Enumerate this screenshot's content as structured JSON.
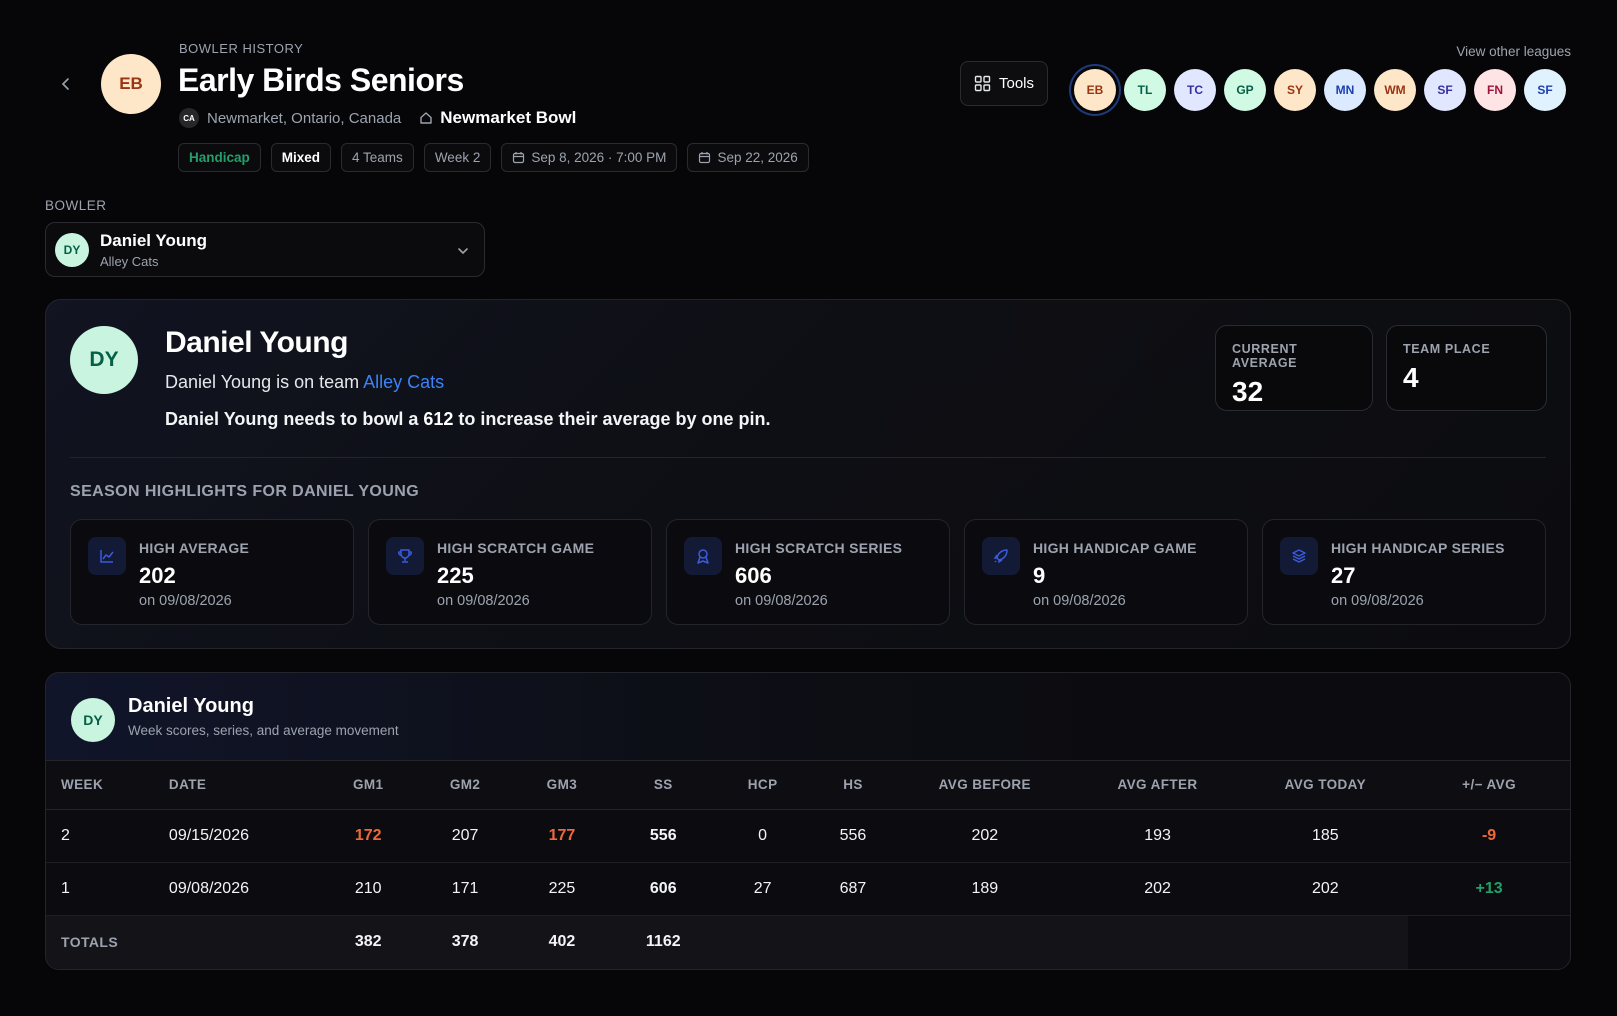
{
  "header": {
    "eyebrow": "BOWLER HISTORY",
    "title": "Early Birds Seniors",
    "avatar": "EB",
    "flag": "CA",
    "location": "Newmarket, Ontario, Canada",
    "venue": "Newmarket Bowl",
    "chips": [
      "Handicap",
      "Mixed",
      "4 Teams",
      "Week 2",
      "Sep 8, 2026 · 7:00 PM",
      "Sep 22, 2026"
    ],
    "tools_label": "Tools",
    "view_other": "View other leagues"
  },
  "leagues": [
    {
      "code": "EB",
      "bg": "#fde7c8",
      "fg": "#9a3412"
    },
    {
      "code": "TL",
      "bg": "#d1fae5",
      "fg": "#065f46"
    },
    {
      "code": "TC",
      "bg": "#e0e7ff",
      "fg": "#3730a3"
    },
    {
      "code": "GP",
      "bg": "#d1fae5",
      "fg": "#065f46"
    },
    {
      "code": "SY",
      "bg": "#fde7c8",
      "fg": "#9a3412"
    },
    {
      "code": "MN",
      "bg": "#dbeafe",
      "fg": "#1e40af"
    },
    {
      "code": "WM",
      "bg": "#fde7c8",
      "fg": "#9a3412"
    },
    {
      "code": "SF",
      "bg": "#e0e7ff",
      "fg": "#3730a3"
    },
    {
      "code": "FN",
      "bg": "#ffe4e6",
      "fg": "#9f1239"
    },
    {
      "code": "SF",
      "bg": "#e0f2fe",
      "fg": "#1e40af"
    }
  ],
  "bowler_select": {
    "label": "BOWLER",
    "initials": "DY",
    "name": "Daniel Young",
    "team": "Alley Cats"
  },
  "profile": {
    "initials": "DY",
    "name": "Daniel Young",
    "team_prefix": "Daniel Young is on team ",
    "team": "Alley Cats",
    "need_prefix": "Daniel Young needs to bowl a ",
    "need_value": "612",
    "need_suffix": " to increase their average by one pin.",
    "current_average_label": "CURRENT AVERAGE",
    "current_average": "32",
    "team_place_label": "TEAM PLACE",
    "team_place": "4",
    "highlights_title": "SEASON HIGHLIGHTS FOR DANIEL YOUNG",
    "highlights": [
      {
        "label": "HIGH AVERAGE",
        "value": "202",
        "date": "on 09/08/2026",
        "icon": "chart-line-icon"
      },
      {
        "label": "HIGH SCRATCH GAME",
        "value": "225",
        "date": "on 09/08/2026",
        "icon": "trophy-icon"
      },
      {
        "label": "HIGH SCRATCH SERIES",
        "value": "606",
        "date": "on 09/08/2026",
        "icon": "award-icon"
      },
      {
        "label": "HIGH HANDICAP GAME",
        "value": "9",
        "date": "on 09/08/2026",
        "icon": "rocket-icon"
      },
      {
        "label": "HIGH HANDICAP SERIES",
        "value": "27",
        "date": "on 09/08/2026",
        "icon": "layers-icon"
      }
    ]
  },
  "history": {
    "initials": "DY",
    "name": "Daniel Young",
    "subtitle": "Week scores, series, and average movement",
    "columns": [
      "WEEK",
      "DATE",
      "GM1",
      "GM2",
      "GM3",
      "SS",
      "HCP",
      "HS",
      "AVG BEFORE",
      "AVG AFTER",
      "AVG TODAY",
      "+/− AVG"
    ],
    "rows": [
      {
        "week": "2",
        "date": "09/15/2026",
        "gm1": "172",
        "gm2": "207",
        "gm3": "177",
        "ss": "556",
        "hcp": "0",
        "hs": "556",
        "avg_before": "202",
        "avg_after": "193",
        "avg_today": "185",
        "diff": "-9"
      },
      {
        "week": "1",
        "date": "09/08/2026",
        "gm1": "210",
        "gm2": "171",
        "gm3": "225",
        "ss": "606",
        "hcp": "27",
        "hs": "687",
        "avg_before": "189",
        "avg_after": "202",
        "avg_today": "202",
        "diff": "+13"
      }
    ],
    "totals": {
      "label": "TOTALS",
      "gm1": "382",
      "gm2": "378",
      "gm3": "402",
      "ss": "1162"
    }
  }
}
